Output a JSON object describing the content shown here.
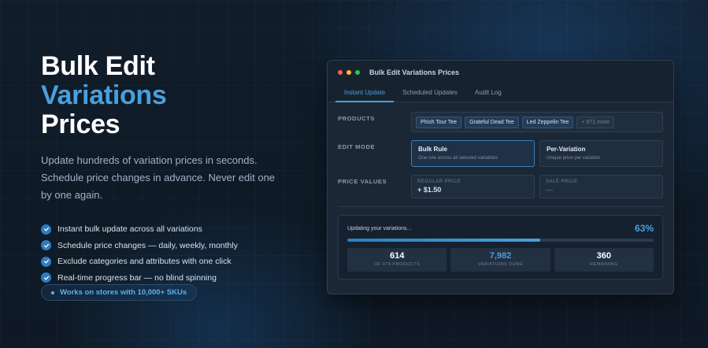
{
  "hero": {
    "title_line1": "Bulk Edit",
    "title_line2": "Variations",
    "title_line3": "Prices",
    "description": "Update hundreds of variation prices in seconds. Schedule price changes in advance. Never edit one by one again.",
    "features": [
      "Instant bulk update across all variations",
      "Schedule price changes — daily, weekly, monthly",
      "Exclude categories and attributes with one click",
      "Real-time progress bar — no blind spinning"
    ],
    "badge": "Works on stores with 10,000+ SKUs"
  },
  "window": {
    "title": "Bulk Edit Variations Prices",
    "lights": [
      "#ff5f57",
      "#febc2e",
      "#28c840"
    ],
    "tabs": [
      "Instant Update",
      "Scheduled Updates",
      "Audit Log"
    ],
    "active_tab": 0,
    "products": {
      "label": "PRODUCTS",
      "chips": [
        "Phish Tour Tee",
        "Grateful Dead Tee",
        "Led Zeppelin Tee"
      ],
      "more": "+ 971 more"
    },
    "edit_mode": {
      "label": "EDIT MODE",
      "options": [
        {
          "title": "Bulk Rule",
          "sub": "One rule across all selected variations"
        },
        {
          "title": "Per-Variation",
          "sub": "Unique price per variation"
        }
      ],
      "selected": 0
    },
    "price_values": {
      "label": "PRICE VALUES",
      "regular_label": "REGULAR PRICE",
      "regular_value": "+ $1.50",
      "sale_label": "SALE PRICE",
      "sale_value": "—"
    },
    "progress": {
      "text": "Updating your variations...",
      "percent_label": "63%",
      "fraction": 0.63,
      "stats": [
        {
          "value": "614",
          "label": "OF 974 PRODUCTS"
        },
        {
          "value": "7,982",
          "label": "VARIATIONS DONE"
        },
        {
          "value": "360",
          "label": "REMAINING"
        }
      ]
    }
  },
  "colors": {
    "accent": "#4a9fdc",
    "background": "#0f1a26",
    "panel": "#1b2735"
  }
}
